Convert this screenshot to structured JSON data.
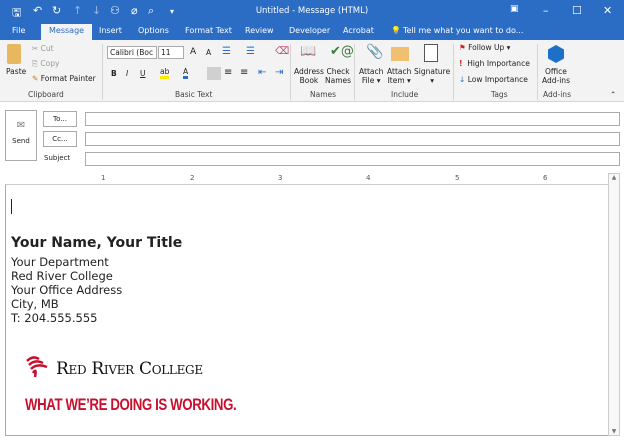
{
  "window": {
    "title": "Untitled - Message (HTML)"
  },
  "tabs": [
    "File",
    "Message",
    "Insert",
    "Options",
    "Format Text",
    "Review",
    "Developer",
    "Acrobat"
  ],
  "tell_me": "Tell me what you want to do...",
  "ribbon": {
    "clipboard": {
      "paste": "Paste",
      "cut": "Cut",
      "copy": "Copy",
      "format_painter": "Format Painter",
      "label": "Clipboard"
    },
    "basic_text": {
      "font": "Calibri (Boc",
      "size": "11",
      "bold": "B",
      "italic": "I",
      "underline": "U",
      "label": "Basic Text"
    },
    "names": {
      "address_book": [
        "Address",
        "Book"
      ],
      "check_names": [
        "Check",
        "Names"
      ],
      "label": "Names"
    },
    "include": {
      "attach_file": [
        "Attach",
        "File ▾"
      ],
      "attach_item": [
        "Attach",
        "Item ▾"
      ],
      "signature": "Signature",
      "label": "Include"
    },
    "tags": {
      "follow_up": "Follow Up ▾",
      "high": "High Importance",
      "low": "Low Importance",
      "label": "Tags"
    },
    "addins": {
      "office": [
        "Office",
        "Add-ins"
      ],
      "label": "Add-ins"
    }
  },
  "compose": {
    "send": "Send",
    "to": "To...",
    "cc": "Cc...",
    "subject": "Subject",
    "to_value": "",
    "cc_value": "",
    "subject_value": ""
  },
  "ruler": [
    "1",
    "2",
    "3",
    "4",
    "5",
    "6"
  ],
  "signature": {
    "name": "Your Name, Your Title",
    "lines": [
      "Your Department",
      "Red River College",
      "Your Office Address",
      "City, MB",
      "T: 204.555.555"
    ],
    "logo_text": "Red River College",
    "tagline": "WHAT WE’RE DOING IS WORKING.",
    "brand_color": "#c8102e"
  }
}
